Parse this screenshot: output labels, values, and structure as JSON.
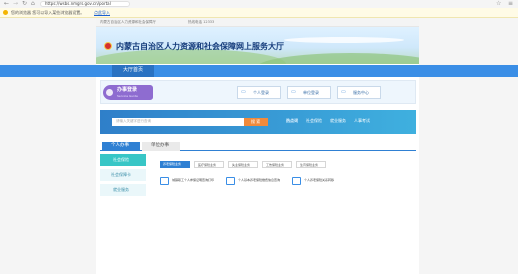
{
  "browser": {
    "address_url": "https://wsbs.nmgrs.gov.cn/portal",
    "infobar_text": "您的浏览器 您可以导入某些浏览器设置。",
    "infobar_link": "点此导入"
  },
  "site": {
    "topstrip_left": "内蒙古自治区人力资源和社会保障厅",
    "topstrip_right": "热线电话 12333",
    "title": "内蒙古自治区人力资源和社会保障网上服务大厅"
  },
  "nav": {
    "home_label": "大厅首页"
  },
  "login": {
    "title": "办事登录",
    "subtitle": "Service Guide",
    "buttons": [
      "个人登录",
      "单位登录",
      "服务中心"
    ]
  },
  "search": {
    "placeholder": "请输入关键字进行查询",
    "button": "搜 索",
    "hot_label": "热点词",
    "hot_words": [
      "社会保险",
      "就业服务",
      "人事考试"
    ]
  },
  "tabs": [
    "个人办事",
    "单位办事"
  ],
  "left_menu": [
    "社会保险",
    "社会保障卡",
    "就业服务"
  ],
  "subtabs": [
    "养老保险业务",
    "医疗保险业务",
    "失业保险业务",
    "工伤保险业务",
    "生育保险业务"
  ],
  "services": [
    "城镇职工个人参保证明查询打印",
    "个人基本养老保险缴费信息查询",
    "个人养老保险关系转移"
  ],
  "colors": {
    "nav_blue": "#3a8ee6",
    "accent_purple": "#8e6cd0",
    "search_orange": "#f08a3c",
    "menu_teal": "#38c6c6"
  }
}
